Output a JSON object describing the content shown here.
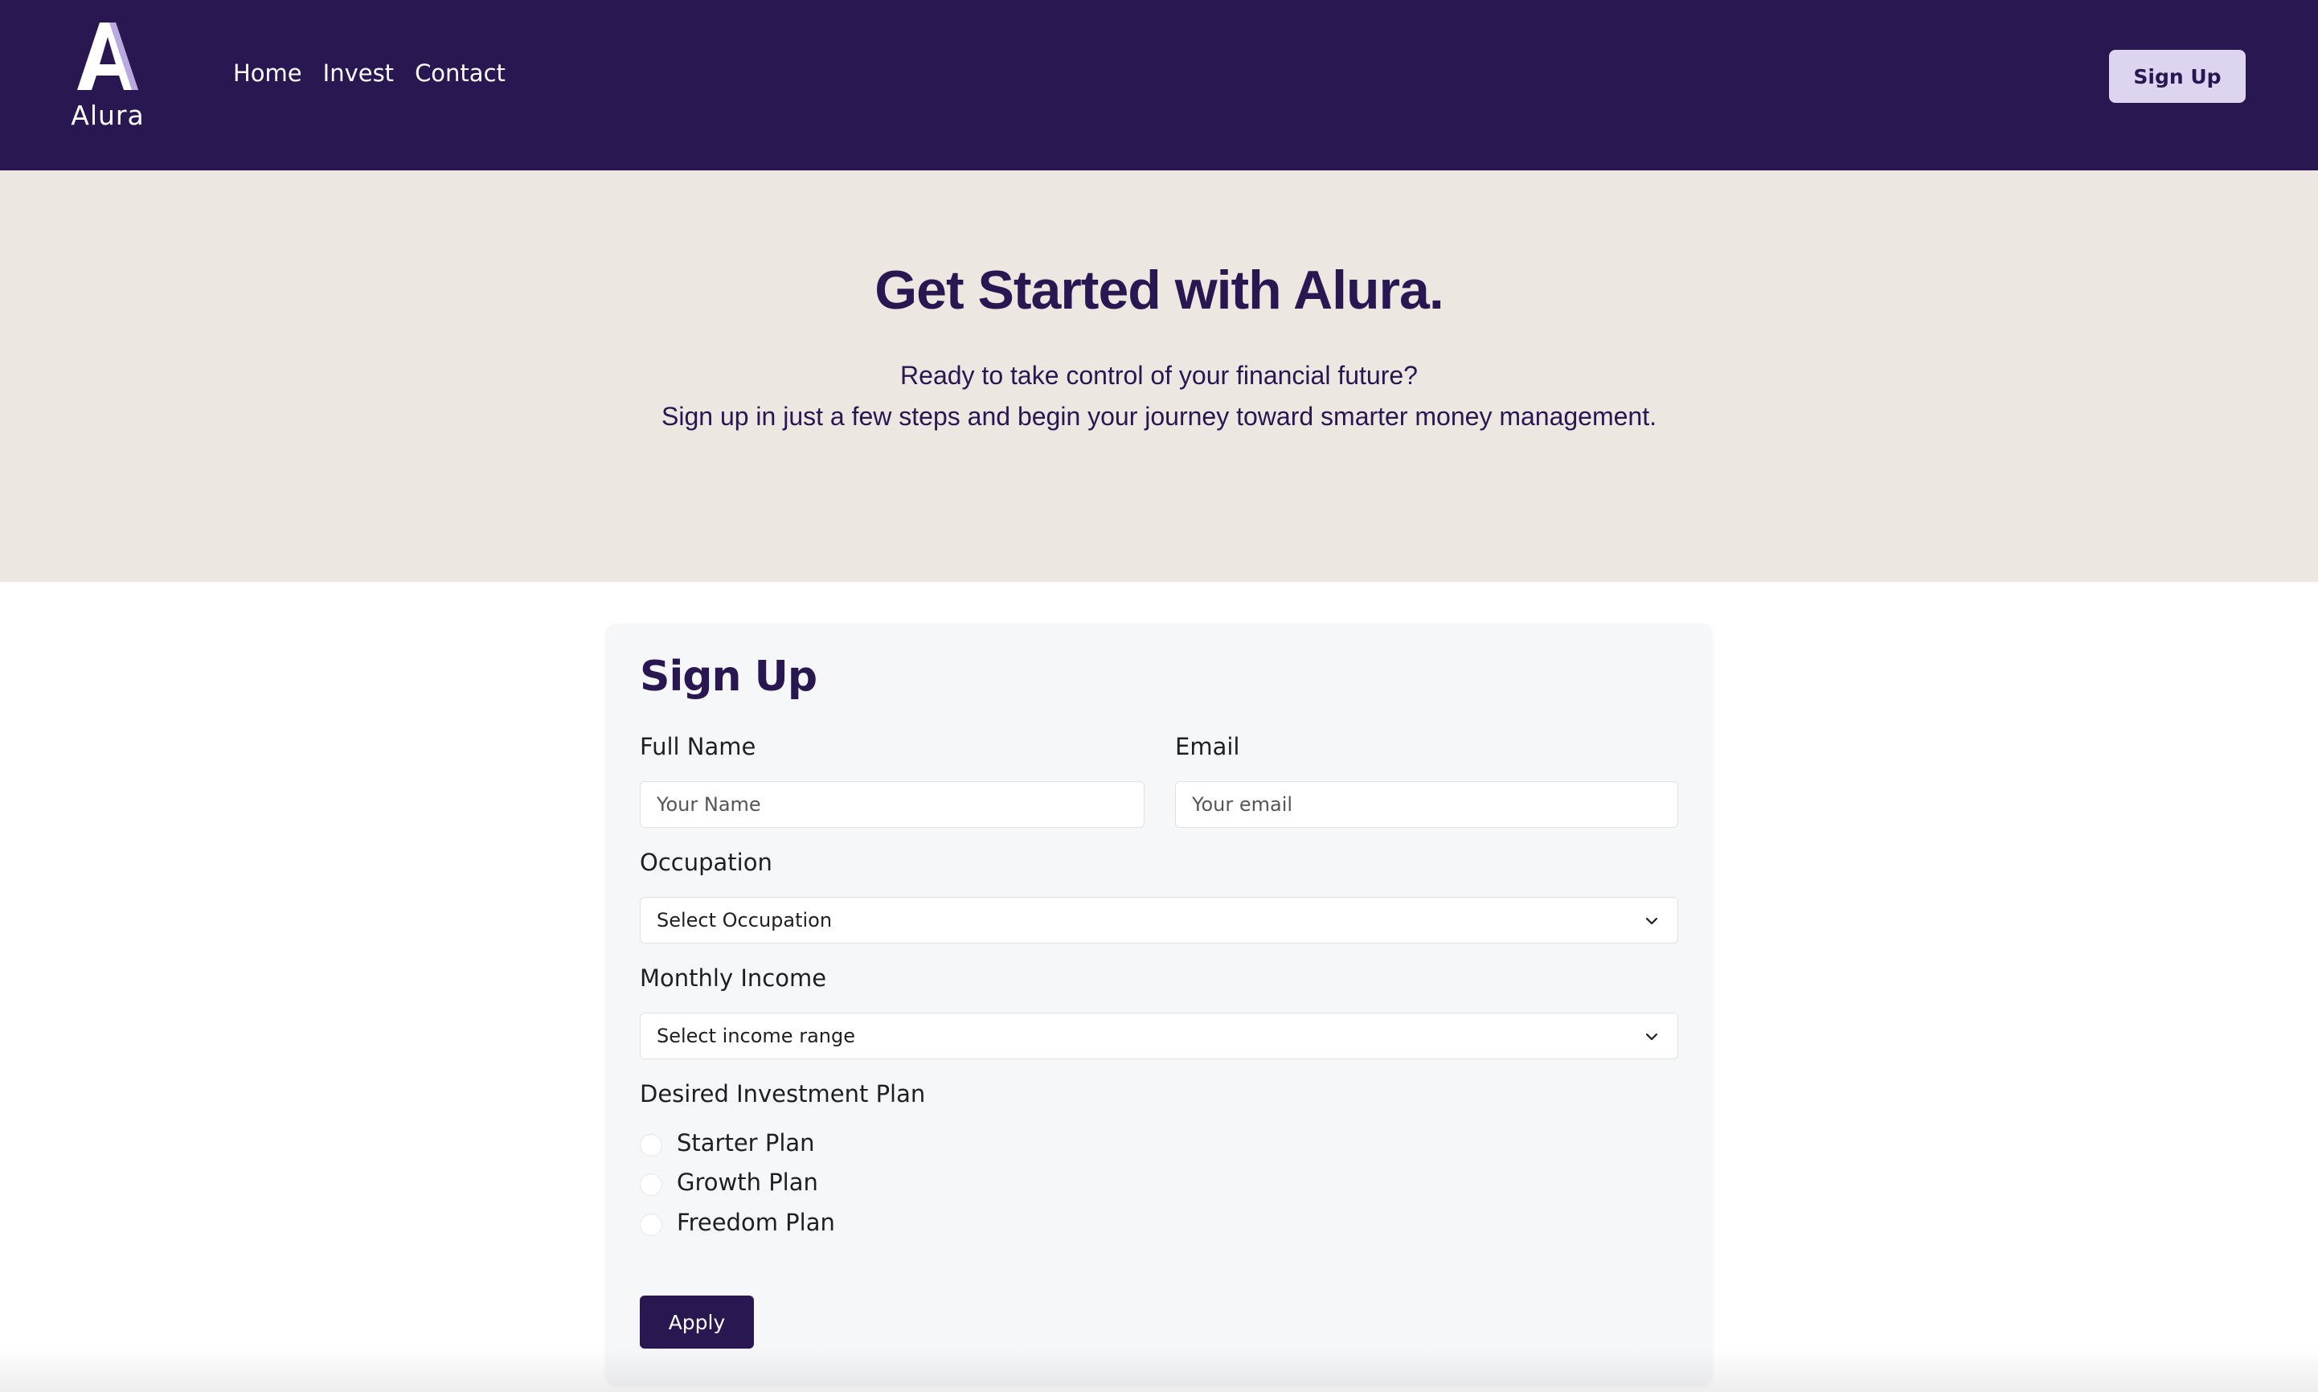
{
  "brand": {
    "logo_letter": "A",
    "name": "Alura"
  },
  "nav": {
    "items": [
      {
        "label": "Home"
      },
      {
        "label": "Invest"
      },
      {
        "label": "Contact"
      }
    ],
    "signup_label": "Sign Up"
  },
  "hero": {
    "title": "Get Started with Alura.",
    "subtitle_line1": "Ready to take control of your financial future?",
    "subtitle_line2": "Sign up in just a few steps and begin your journey toward smarter money management."
  },
  "form": {
    "title": "Sign Up",
    "full_name": {
      "label": "Full Name",
      "placeholder": "Your Name",
      "value": ""
    },
    "email": {
      "label": "Email",
      "placeholder": "Your email",
      "value": ""
    },
    "occupation": {
      "label": "Occupation",
      "selected": "Select Occupation",
      "icon": "chevron-down-icon"
    },
    "income": {
      "label": "Monthly Income",
      "selected": "Select income range",
      "icon": "chevron-down-icon"
    },
    "plan": {
      "label": "Desired Investment Plan",
      "options": [
        {
          "label": "Starter Plan",
          "checked": false
        },
        {
          "label": "Growth Plan",
          "checked": false
        },
        {
          "label": "Freedom Plan",
          "checked": false
        }
      ]
    },
    "apply_label": "Apply"
  },
  "colors": {
    "brand_dark": "#291751",
    "brand_light": "#ddd4f0",
    "hero_bg": "#ede7e2",
    "card_bg": "#f6f7f9"
  }
}
